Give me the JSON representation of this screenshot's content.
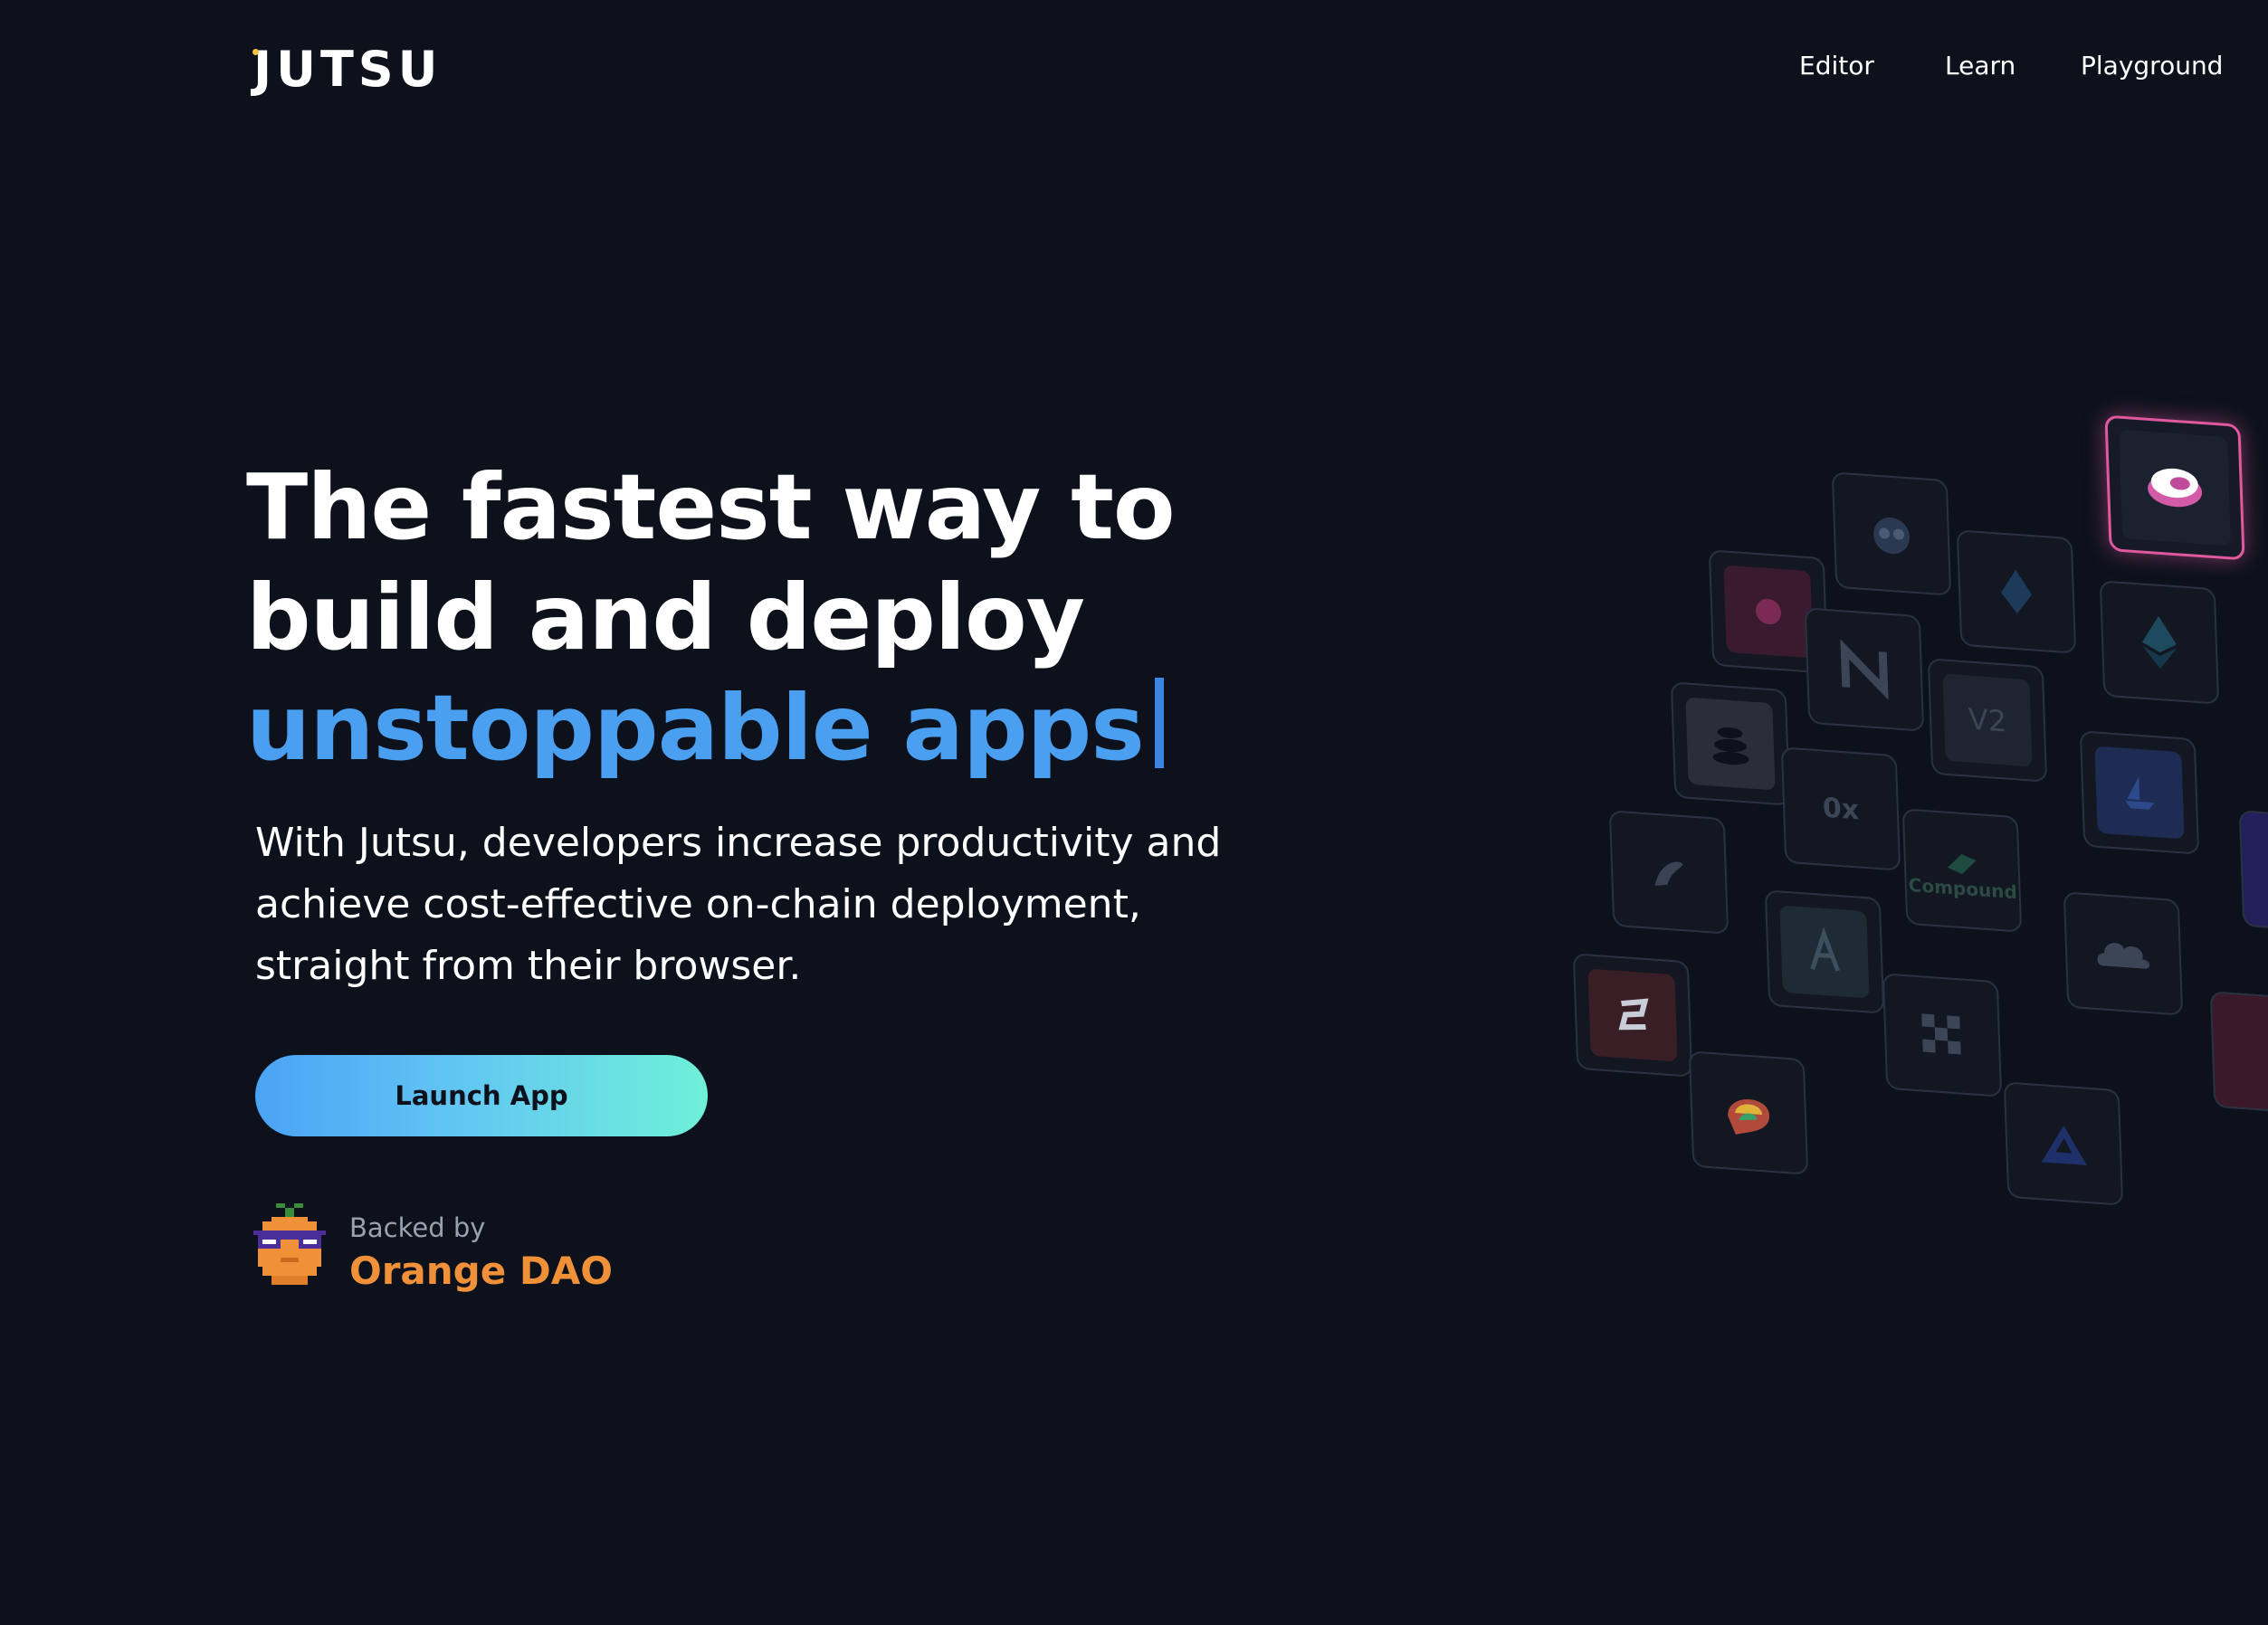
{
  "header": {
    "logo_text": "JUTSU",
    "nav": [
      {
        "label": "Editor"
      },
      {
        "label": "Learn"
      },
      {
        "label": "Playground"
      }
    ]
  },
  "hero": {
    "title_line1": "The fastest way to",
    "title_line2": "build and deploy",
    "title_line3": "unstoppable apps",
    "subtitle_line1": "With Jutsu, developers increase productivity and",
    "subtitle_line2": "achieve cost-effective on-chain deployment,",
    "subtitle_line3": "straight from their browser.",
    "cta_label": "Launch App"
  },
  "backer": {
    "label": "Backed by",
    "name": "Orange DAO"
  },
  "tiles": {
    "v2_label": "V2",
    "zero_x_label": "0x",
    "compound_label": "Compound"
  },
  "colors": {
    "background": "#0d111c",
    "accent_blue": "#4a9ff0",
    "orange": "#f0913a",
    "cta_gradient_start": "#4aa3f5",
    "cta_gradient_end": "#6ff0d8"
  }
}
